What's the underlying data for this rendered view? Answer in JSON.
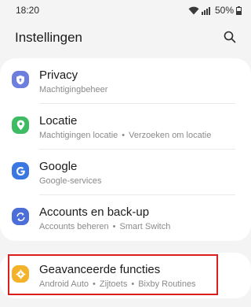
{
  "status_bar": {
    "time": "18:20",
    "battery_percent": "50%",
    "icons": [
      "wifi-icon",
      "signal-icon",
      "battery-icon"
    ]
  },
  "header": {
    "title": "Instellingen",
    "search_icon": "search-icon"
  },
  "settings": [
    {
      "title": "Privacy",
      "subtitle_parts": [
        "Machtigingbeheer"
      ],
      "icon": "shield-icon",
      "icon_color": "#6c7fdc"
    },
    {
      "title": "Locatie",
      "subtitle_parts": [
        "Machtigingen locatie",
        "Verzoeken om locatie"
      ],
      "icon": "location-pin-icon",
      "icon_color": "#3ebc63"
    },
    {
      "title": "Google",
      "subtitle_parts": [
        "Google-services"
      ],
      "icon": "google-icon",
      "icon_color": "#3a77e0"
    },
    {
      "title": "Accounts en back-up",
      "subtitle_parts": [
        "Accounts beheren",
        "Smart Switch"
      ],
      "icon": "sync-icon",
      "icon_color": "#4b6ed8"
    }
  ],
  "advanced": {
    "title": "Geavanceerde functies",
    "subtitle_parts": [
      "Android Auto",
      "Zijtoets",
      "Bixby Routines"
    ],
    "icon": "gear-plus-icon",
    "icon_color": "#f3b22a"
  },
  "separator": "•"
}
